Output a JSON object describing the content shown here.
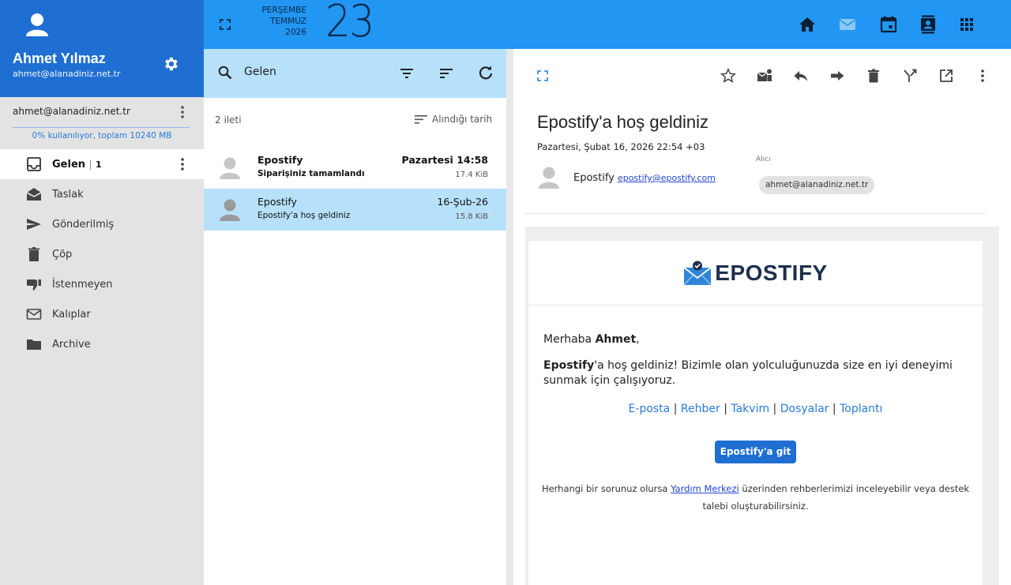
{
  "user": {
    "name": "Ahmet Yılmaz",
    "email": "ahmet@alanadiniz.net.tr"
  },
  "account": {
    "email": "ahmet@alanadiniz.net.tr",
    "usage": "0% kullanılıyor, toplam 10240 MB",
    "usage_percent": 0
  },
  "folders": [
    {
      "label": "Gelen",
      "count": "1",
      "icon": "inbox-icon",
      "active": true
    },
    {
      "label": "Taslak",
      "icon": "drafts-icon"
    },
    {
      "label": "Gönderilmiş",
      "icon": "send-icon"
    },
    {
      "label": "Çöp",
      "icon": "trash-icon"
    },
    {
      "label": "İstenmeyen",
      "icon": "thumb-down-icon"
    },
    {
      "label": "Kalıplar",
      "icon": "mail-outline-icon"
    },
    {
      "label": "Archive",
      "icon": "folder-icon"
    }
  ],
  "topbar": {
    "weekday": "PERŞEMBE",
    "month": "TEMMUZ",
    "year": "2026",
    "day": "23",
    "icons": [
      "home-icon",
      "mail-icon",
      "calendar-icon",
      "contacts-icon",
      "apps-grid-icon"
    ]
  },
  "list": {
    "folder_title": "Gelen",
    "count_label": "2 ileti",
    "sort_label": "Alındığı tarih",
    "messages": [
      {
        "sender": "Epostify",
        "subject": "Siparişiniz tamamlandı",
        "date": "Pazartesi 14:58",
        "size": "17.4 KiB",
        "unread": true
      },
      {
        "sender": "Epostify",
        "subject": "Epostify'a hoş geldiniz",
        "date": "16-Şub-26",
        "size": "15.8 KiB",
        "selected": true
      }
    ]
  },
  "reader": {
    "toolbar_icons": [
      "star-icon",
      "mark-read-icon",
      "reply-icon",
      "forward-icon",
      "delete-icon",
      "merge-icon",
      "open-external-icon",
      "more-vert-icon"
    ],
    "subject": "Epostify'a hoş geldiniz",
    "dateline": "Pazartesi, Şubat 16, 2026 22:54 +03",
    "from_name": "Epostify",
    "from_address": "epostify@epostify.com",
    "to_label": "Alıcı",
    "to_address": "ahmet@alanadiniz.net.tr"
  },
  "email_body": {
    "logo_text": "EPOSTIFY",
    "greeting_prefix": "Merhaba ",
    "greeting_name": "Ahmet",
    "greeting_suffix": ",",
    "para_brand": "Epostify",
    "para_text": "'a hoş geldiniz! Bizimle olan yolculuğunuzda size en iyi deneyimi sunmak için çalışıyoruz.",
    "links": [
      "E-posta",
      "Rehber",
      "Takvim",
      "Dosyalar",
      "Toplantı"
    ],
    "link_separator": "|",
    "cta": "Epostify'a git",
    "help_prefix": "Herhangi bir sorunuz olursa ",
    "help_link": "Yardım Merkezi",
    "help_suffix": " üzerinden rehberlerimizi inceleyebilir veya destek talebi oluşturabilirsiniz."
  },
  "colors": {
    "profile_bg": "#1f6fd2",
    "topbar_bg": "#2196f3",
    "selection_bg": "#b7e1fb",
    "sidebar_bg": "#e3e3e3",
    "link": "#2a7bd8",
    "cta_bg": "#1f6fd2"
  }
}
